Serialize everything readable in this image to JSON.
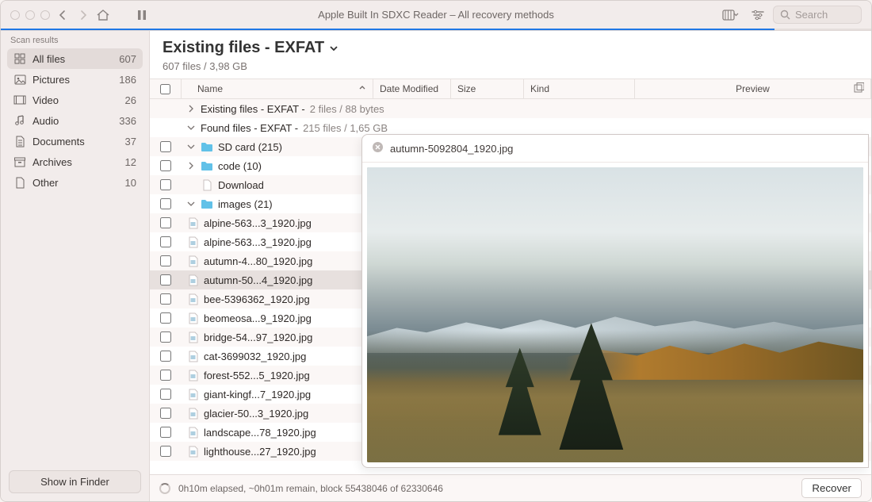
{
  "window": {
    "title": "Apple Built In SDXC Reader – All recovery methods",
    "search_placeholder": "Search"
  },
  "progress": {
    "percent": 88.9
  },
  "sidebar": {
    "section": "Scan results",
    "items": [
      {
        "label": "All files",
        "count": "607",
        "icon": "grid"
      },
      {
        "label": "Pictures",
        "count": "186",
        "icon": "picture"
      },
      {
        "label": "Video",
        "count": "26",
        "icon": "video"
      },
      {
        "label": "Audio",
        "count": "336",
        "icon": "audio"
      },
      {
        "label": "Documents",
        "count": "37",
        "icon": "document"
      },
      {
        "label": "Archives",
        "count": "12",
        "icon": "archive"
      },
      {
        "label": "Other",
        "count": "10",
        "icon": "other"
      }
    ],
    "footer_button": "Show in Finder"
  },
  "header": {
    "title": "Existing files - EXFAT",
    "subtitle": "607 files / 3,98 GB"
  },
  "columns": {
    "name": "Name",
    "date": "Date Modified",
    "size": "Size",
    "kind": "Kind",
    "preview": "Preview"
  },
  "groups": {
    "existing": {
      "prefix": "Existing files - EXFAT - ",
      "meta": "2 files / 88 bytes"
    },
    "found": {
      "prefix": "Found files - EXFAT - ",
      "meta": "215 files / 1,65 GB"
    }
  },
  "tree": {
    "root": "SD card (215)",
    "code": "code (10)",
    "download": "Download",
    "images": "images (21)"
  },
  "files": [
    "alpine-563...3_1920.jpg",
    "alpine-563...3_1920.jpg",
    "autumn-4...80_1920.jpg",
    "autumn-50...4_1920.jpg",
    "bee-5396362_1920.jpg",
    "beomeosa...9_1920.jpg",
    "bridge-54...97_1920.jpg",
    "cat-3699032_1920.jpg",
    "forest-552...5_1920.jpg",
    "giant-kingf...7_1920.jpg",
    "glacier-50...3_1920.jpg",
    "landscape...78_1920.jpg",
    "lighthouse...27_1920.jpg"
  ],
  "preview": {
    "filename": "autumn-5092804_1920.jpg"
  },
  "status": {
    "text": "0h10m elapsed, ~0h01m remain, block 55438046 of 62330646",
    "recover": "Recover"
  }
}
